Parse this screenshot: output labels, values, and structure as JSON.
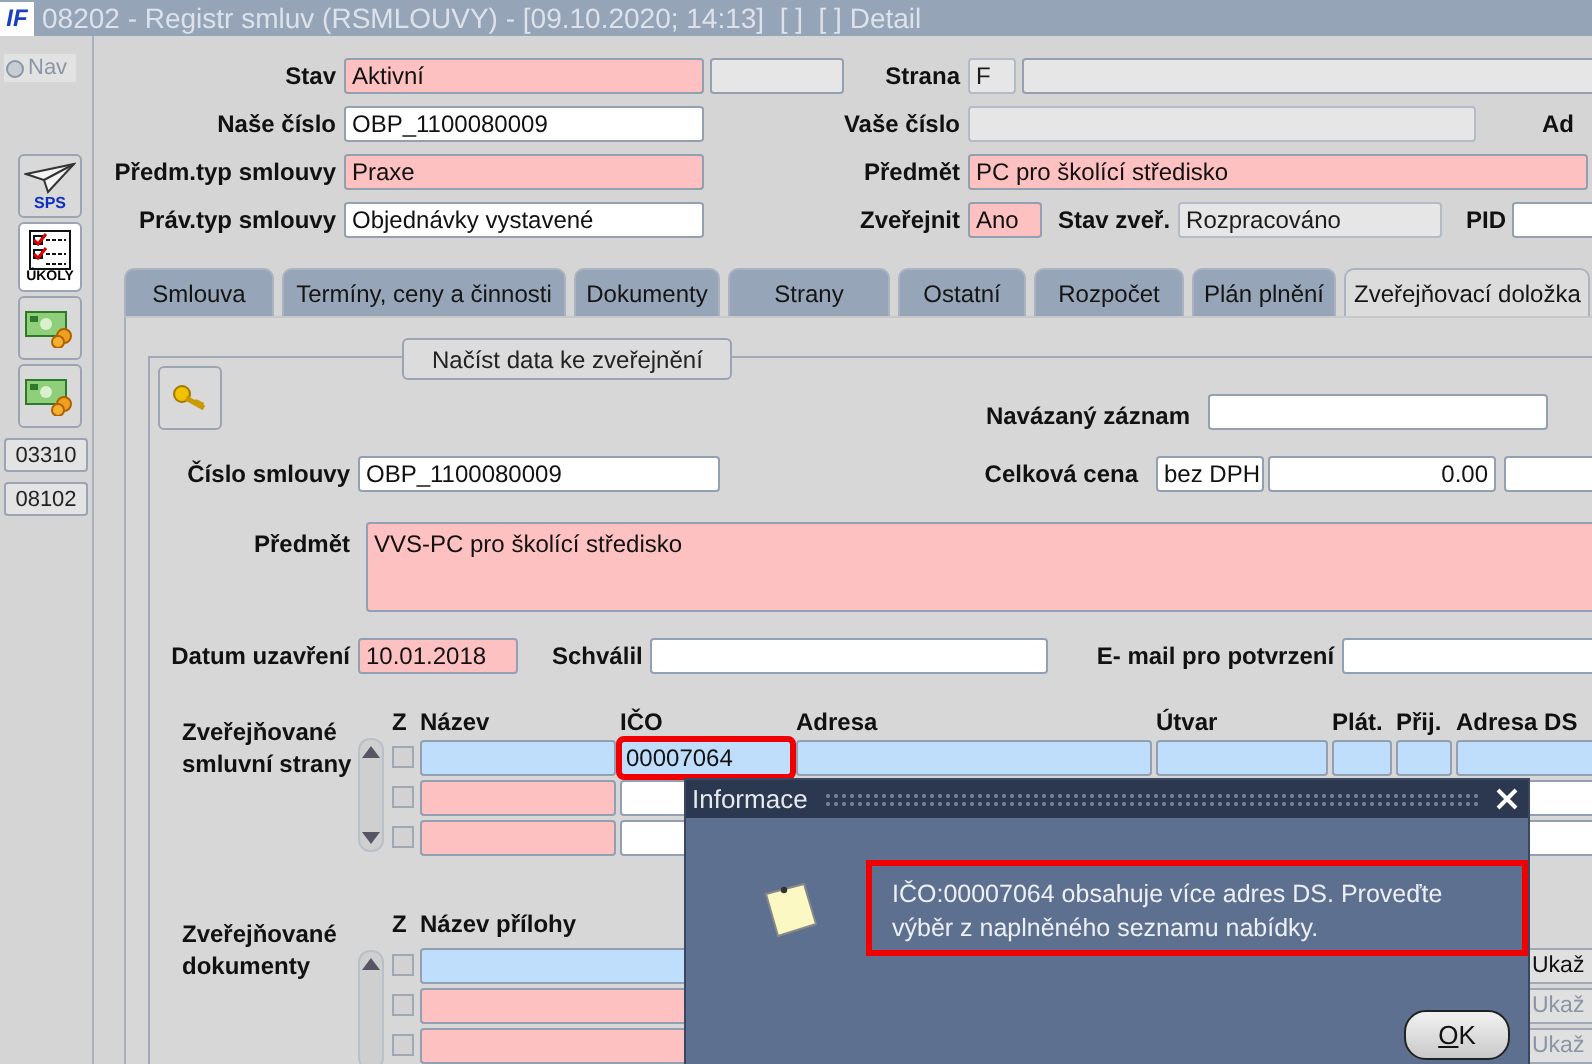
{
  "window": {
    "logo": "IF",
    "title": "08202 - Registr smluv (RSMLOUVY) - [09.10.2020; 14:13]  [ ]  [ ] Detail"
  },
  "sidebar": {
    "nav": {
      "label": "Nav",
      "selected": false,
      "disabled": true
    },
    "tools": [
      {
        "kind": "plane",
        "label": "SPS"
      },
      {
        "kind": "checklist",
        "label": "ÚKOLY"
      },
      {
        "kind": "money"
      },
      {
        "kind": "money"
      },
      {
        "kind": "code",
        "label": "03310"
      },
      {
        "kind": "code",
        "label": "08102"
      }
    ]
  },
  "header": {
    "stav": {
      "label": "Stav",
      "value": "Aktivní",
      "required": true,
      "readonly": false
    },
    "strana": {
      "label": "Strana",
      "value": "F",
      "required": false,
      "readonly": true
    },
    "nase_cislo": {
      "label": "Naše číslo",
      "value": "OBP_1100080009",
      "required": false,
      "readonly": false
    },
    "vase_cislo": {
      "label": "Vaše číslo",
      "required": false,
      "readonly": true
    },
    "ad": {
      "label": "Ad"
    },
    "predm_typ": {
      "label": "Předm.typ smlouvy",
      "value": "Praxe",
      "required": true,
      "readonly": false
    },
    "predmet": {
      "label": "Předmět",
      "value": "PC pro školící středisko",
      "required": true,
      "readonly": false
    },
    "prav_typ": {
      "label": "Práv.typ smlouvy",
      "value": "Objednávky vystavené",
      "required": false,
      "readonly": false
    },
    "zverejnit": {
      "label": "Zveřejnit",
      "value": "Ano",
      "required": true,
      "readonly": false
    },
    "stav_zver": {
      "label": "Stav zveř.",
      "value": "Rozpracováno",
      "required": false,
      "readonly": true
    },
    "pid": {
      "label": "PID",
      "required": false,
      "readonly": false
    }
  },
  "tabs": [
    {
      "label": "Smlouva",
      "selected": false
    },
    {
      "label": "Termíny, ceny a činnosti",
      "selected": false
    },
    {
      "label": "Dokumenty",
      "selected": false
    },
    {
      "label": "Strany",
      "selected": false
    },
    {
      "label": "Ostatní",
      "selected": false
    },
    {
      "label": "Rozpočet",
      "selected": false
    },
    {
      "label": "Plán plnění",
      "selected": false
    },
    {
      "label": "Zveřejňovací doložka",
      "selected": true
    }
  ],
  "panel": {
    "load_button": "Načíst data ke zveřejnění",
    "linked_record": {
      "label": "Navázaný záznam",
      "required": false,
      "readonly": false
    },
    "contract_number": {
      "label": "Číslo smlouvy",
      "value": "OBP_1100080009",
      "required": false,
      "readonly": false
    },
    "total_price": {
      "label": "Celková cena",
      "vat": "bez DPH",
      "amount": "0.00"
    },
    "subject": {
      "label": "Předmět",
      "value": "VVS-PC pro školící středisko",
      "required": true,
      "readonly": false
    },
    "date_closed": {
      "label": "Datum uzavření",
      "value": "10.01.2018",
      "required": true,
      "readonly": false
    },
    "approved_by": {
      "label": "Schválil",
      "required": false,
      "readonly": false
    },
    "email": {
      "label": "E- mail pro potvrzení",
      "required": false,
      "readonly": false
    },
    "parties": {
      "label": "Zveřejňované smluvní strany",
      "columns": [
        "Z",
        "Název",
        "IČO",
        "Adresa",
        "Útvar",
        "Plát.",
        "Přij.",
        "Adresa DS"
      ],
      "rows": [
        {
          "current": true,
          "checked": false,
          "ico": "00007064",
          "highlighted": true
        },
        {
          "current": false,
          "checked": false,
          "highlighted": false
        },
        {
          "current": false,
          "checked": false,
          "highlighted": false
        }
      ]
    },
    "documents": {
      "label": "Zveřejňované dokumenty",
      "columns": [
        "Z",
        "Název přílohy"
      ],
      "rows": [
        {
          "current": true,
          "checked": false,
          "button": "Ukaž",
          "disabled": false
        },
        {
          "current": false,
          "checked": false,
          "button": "Ukaž",
          "disabled": true
        },
        {
          "current": false,
          "checked": false,
          "button": "Ukaž",
          "disabled": true
        }
      ]
    }
  },
  "dialog": {
    "title": "Informace",
    "message": "IČO:00007064 obsahuje více adres DS. Proveďte výběr z naplněného seznamu nabídky.",
    "highlighted": true,
    "ok": "OK"
  }
}
